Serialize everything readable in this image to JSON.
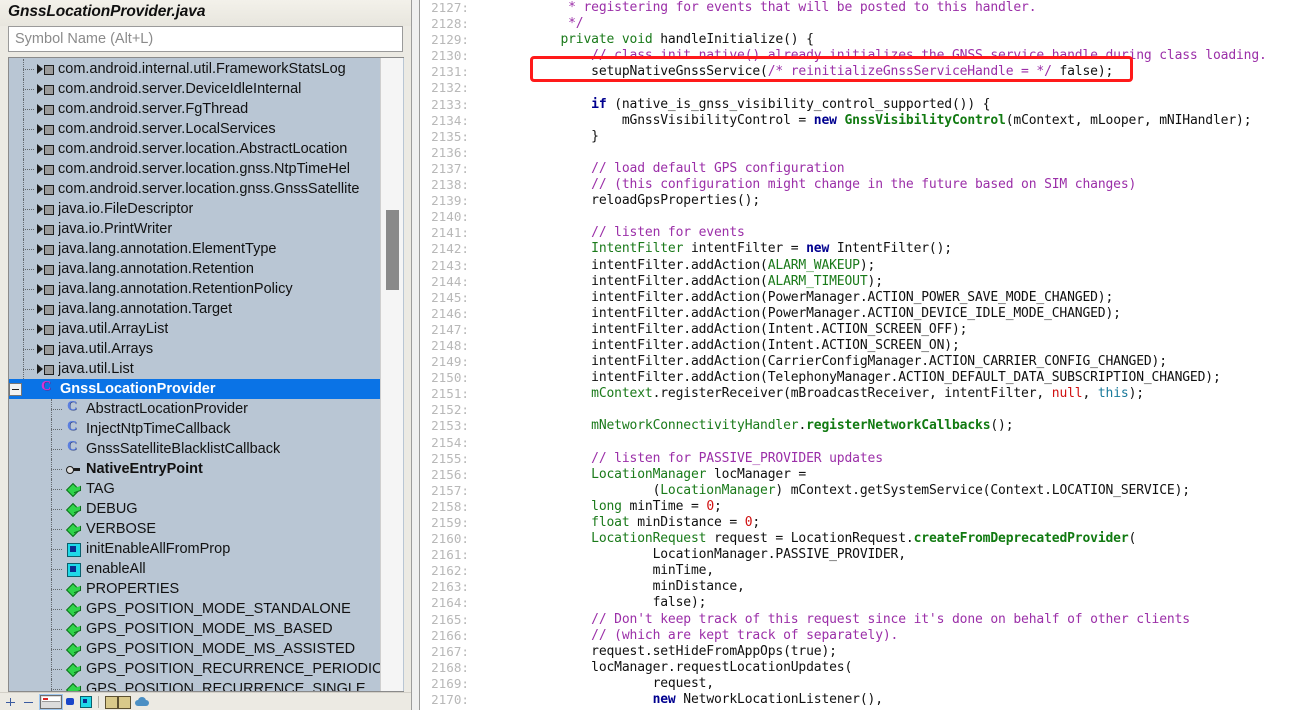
{
  "panel": {
    "title": "GnssLocationProvider.java",
    "search_placeholder": "Symbol Name (Alt+L)",
    "search_value": "",
    "tree": [
      {
        "label": "com.android.internal.util.FrameworkStatsLog",
        "icon": "import-icon",
        "kind": "import",
        "depth": 1,
        "selected": false
      },
      {
        "label": "com.android.server.DeviceIdleInternal",
        "icon": "import-icon",
        "kind": "import",
        "depth": 1,
        "selected": false
      },
      {
        "label": "com.android.server.FgThread",
        "icon": "import-icon",
        "kind": "import",
        "depth": 1,
        "selected": false
      },
      {
        "label": "com.android.server.LocalServices",
        "icon": "import-icon",
        "kind": "import",
        "depth": 1,
        "selected": false
      },
      {
        "label": "com.android.server.location.AbstractLocation",
        "icon": "import-icon",
        "kind": "import",
        "depth": 1,
        "selected": false
      },
      {
        "label": "com.android.server.location.gnss.NtpTimeHel",
        "icon": "import-icon",
        "kind": "import",
        "depth": 1,
        "selected": false
      },
      {
        "label": "com.android.server.location.gnss.GnssSatellite",
        "icon": "import-icon",
        "kind": "import",
        "depth": 1,
        "selected": false
      },
      {
        "label": "java.io.FileDescriptor",
        "icon": "import-icon",
        "kind": "import",
        "depth": 1,
        "selected": false
      },
      {
        "label": "java.io.PrintWriter",
        "icon": "import-icon",
        "kind": "import",
        "depth": 1,
        "selected": false
      },
      {
        "label": "java.lang.annotation.ElementType",
        "icon": "import-icon",
        "kind": "import",
        "depth": 1,
        "selected": false
      },
      {
        "label": "java.lang.annotation.Retention",
        "icon": "import-icon",
        "kind": "import",
        "depth": 1,
        "selected": false
      },
      {
        "label": "java.lang.annotation.RetentionPolicy",
        "icon": "import-icon",
        "kind": "import",
        "depth": 1,
        "selected": false
      },
      {
        "label": "java.lang.annotation.Target",
        "icon": "import-icon",
        "kind": "import",
        "depth": 1,
        "selected": false
      },
      {
        "label": "java.util.ArrayList",
        "icon": "import-icon",
        "kind": "import",
        "depth": 1,
        "selected": false
      },
      {
        "label": "java.util.Arrays",
        "icon": "import-icon",
        "kind": "import",
        "depth": 1,
        "selected": false
      },
      {
        "label": "java.util.List",
        "icon": "import-icon",
        "kind": "import",
        "depth": 1,
        "selected": false
      },
      {
        "label": "GnssLocationProvider",
        "icon": "class-icon",
        "kind": "class-selected",
        "depth": 0,
        "selected": true,
        "expanded": true
      },
      {
        "label": "AbstractLocationProvider",
        "icon": "class-icon",
        "kind": "class",
        "depth": 2,
        "selected": false
      },
      {
        "label": "InjectNtpTimeCallback",
        "icon": "class-icon",
        "kind": "class",
        "depth": 2,
        "selected": false
      },
      {
        "label": "GnssSatelliteBlacklistCallback",
        "icon": "class-icon",
        "kind": "class",
        "depth": 2,
        "selected": false
      },
      {
        "label": "NativeEntryPoint",
        "icon": "interface-icon",
        "kind": "interface",
        "depth": 2,
        "selected": false
      },
      {
        "label": "TAG",
        "icon": "field-icon",
        "kind": "field",
        "depth": 2,
        "selected": false
      },
      {
        "label": "DEBUG",
        "icon": "field-icon",
        "kind": "field",
        "depth": 2,
        "selected": false
      },
      {
        "label": "VERBOSE",
        "icon": "field-icon",
        "kind": "field",
        "depth": 2,
        "selected": false
      },
      {
        "label": "initEnableAllFromProp",
        "icon": "method-icon",
        "kind": "method",
        "depth": 2,
        "selected": false
      },
      {
        "label": "enableAll",
        "icon": "method-icon",
        "kind": "method",
        "depth": 2,
        "selected": false
      },
      {
        "label": "PROPERTIES",
        "icon": "field-icon",
        "kind": "field",
        "depth": 2,
        "selected": false
      },
      {
        "label": "GPS_POSITION_MODE_STANDALONE",
        "icon": "field-icon",
        "kind": "field",
        "depth": 2,
        "selected": false
      },
      {
        "label": "GPS_POSITION_MODE_MS_BASED",
        "icon": "field-icon",
        "kind": "field",
        "depth": 2,
        "selected": false
      },
      {
        "label": "GPS_POSITION_MODE_MS_ASSISTED",
        "icon": "field-icon",
        "kind": "field",
        "depth": 2,
        "selected": false
      },
      {
        "label": "GPS_POSITION_RECURRENCE_PERIODIC",
        "icon": "field-icon",
        "kind": "field",
        "depth": 2,
        "selected": false
      },
      {
        "label": "GPS_POSITION_RECURRENCE_SINGLE",
        "icon": "field-icon",
        "kind": "field",
        "depth": 2,
        "selected": false
      }
    ],
    "toolbar": [
      {
        "name": "expand-plus-button",
        "icon": "plus-icon"
      },
      {
        "name": "collapse-minus-button",
        "icon": "minus-icon"
      },
      {
        "name": "window-view-button",
        "icon": "window-icon"
      },
      {
        "name": "symbol-dot-button",
        "icon": "blue-dot-icon"
      },
      {
        "name": "method-filter-button",
        "icon": "cyan-square-icon"
      },
      {
        "name": "books-button",
        "icon": "books-icon"
      },
      {
        "name": "cloud-button",
        "icon": "cloud-icon"
      }
    ]
  },
  "editor": {
    "accent_highlight_color": "#ff1a1a",
    "first_line_number": 2127,
    "lines": [
      {
        "n": "2127:",
        "tokens": [
          {
            "t": "            * registering for events that will be posted to this handler.",
            "c": "cmt"
          }
        ]
      },
      {
        "n": "2128:",
        "tokens": [
          {
            "t": "            */",
            "c": "cmt"
          }
        ]
      },
      {
        "n": "2129:",
        "tokens": [
          {
            "t": "           ",
            "c": "pl"
          },
          {
            "t": "private void",
            "c": "typ"
          },
          {
            "t": " handleInitialize() {",
            "c": "pl"
          }
        ]
      },
      {
        "n": "2130:",
        "tokens": [
          {
            "t": "               ",
            "c": "pl"
          },
          {
            "t": "// class init native() already initializes the GNSS service handle during class loading.",
            "c": "cmt"
          }
        ]
      },
      {
        "n": "2131:",
        "tokens": [
          {
            "t": "               setupNativeGnssService(",
            "c": "pl"
          },
          {
            "t": "/* reinitializeGnssServiceHandle = */",
            "c": "cmt"
          },
          {
            "t": " false);",
            "c": "pl"
          }
        ]
      },
      {
        "n": "2132:",
        "tokens": [
          {
            "t": "",
            "c": "pl"
          }
        ]
      },
      {
        "n": "2133:",
        "tokens": [
          {
            "t": "               ",
            "c": "pl"
          },
          {
            "t": "if",
            "c": "kw"
          },
          {
            "t": " (native_is_gnss_visibility_control_supported()) {",
            "c": "pl"
          }
        ]
      },
      {
        "n": "2134:",
        "tokens": [
          {
            "t": "                   mGnssVisibilityControl = ",
            "c": "pl"
          },
          {
            "t": "new",
            "c": "kw"
          },
          {
            "t": " ",
            "c": "pl"
          },
          {
            "t": "GnssVisibilityControl",
            "c": "cls"
          },
          {
            "t": "(mContext, mLooper, mNIHandler);",
            "c": "pl"
          }
        ]
      },
      {
        "n": "2135:",
        "tokens": [
          {
            "t": "               }",
            "c": "pl"
          }
        ]
      },
      {
        "n": "2136:",
        "tokens": [
          {
            "t": "",
            "c": "pl"
          }
        ]
      },
      {
        "n": "2137:",
        "tokens": [
          {
            "t": "               ",
            "c": "pl"
          },
          {
            "t": "// load default GPS configuration",
            "c": "cmt"
          }
        ]
      },
      {
        "n": "2138:",
        "tokens": [
          {
            "t": "               ",
            "c": "pl"
          },
          {
            "t": "// (this configuration might change in the future based on SIM changes)",
            "c": "cmt"
          }
        ]
      },
      {
        "n": "2139:",
        "tokens": [
          {
            "t": "               reloadGpsProperties();",
            "c": "pl"
          }
        ]
      },
      {
        "n": "2140:",
        "tokens": [
          {
            "t": "",
            "c": "pl"
          }
        ]
      },
      {
        "n": "2141:",
        "tokens": [
          {
            "t": "               ",
            "c": "pl"
          },
          {
            "t": "// listen for events",
            "c": "cmt"
          }
        ]
      },
      {
        "n": "2142:",
        "tokens": [
          {
            "t": "               ",
            "c": "pl"
          },
          {
            "t": "IntentFilter",
            "c": "typ"
          },
          {
            "t": " intentFilter = ",
            "c": "pl"
          },
          {
            "t": "new",
            "c": "kw"
          },
          {
            "t": " IntentFilter();",
            "c": "pl"
          }
        ]
      },
      {
        "n": "2143:",
        "tokens": [
          {
            "t": "               intentFilter.addAction(",
            "c": "pl"
          },
          {
            "t": "ALARM_WAKEUP",
            "c": "fld"
          },
          {
            "t": ");",
            "c": "pl"
          }
        ]
      },
      {
        "n": "2144:",
        "tokens": [
          {
            "t": "               intentFilter.addAction(",
            "c": "pl"
          },
          {
            "t": "ALARM_TIMEOUT",
            "c": "fld"
          },
          {
            "t": ");",
            "c": "pl"
          }
        ]
      },
      {
        "n": "2145:",
        "tokens": [
          {
            "t": "               intentFilter.addAction(PowerManager.ACTION_POWER_SAVE_MODE_CHANGED);",
            "c": "pl"
          }
        ]
      },
      {
        "n": "2146:",
        "tokens": [
          {
            "t": "               intentFilter.addAction(PowerManager.ACTION_DEVICE_IDLE_MODE_CHANGED);",
            "c": "pl"
          }
        ]
      },
      {
        "n": "2147:",
        "tokens": [
          {
            "t": "               intentFilter.addAction(Intent.ACTION_SCREEN_OFF);",
            "c": "pl"
          }
        ]
      },
      {
        "n": "2148:",
        "tokens": [
          {
            "t": "               intentFilter.addAction(Intent.ACTION_SCREEN_ON);",
            "c": "pl"
          }
        ]
      },
      {
        "n": "2149:",
        "tokens": [
          {
            "t": "               intentFilter.addAction(CarrierConfigManager.ACTION_CARRIER_CONFIG_CHANGED);",
            "c": "pl"
          }
        ]
      },
      {
        "n": "2150:",
        "tokens": [
          {
            "t": "               intentFilter.addAction(TelephonyManager.ACTION_DEFAULT_DATA_SUBSCRIPTION_CHANGED);",
            "c": "pl"
          }
        ]
      },
      {
        "n": "2151:",
        "tokens": [
          {
            "t": "               ",
            "c": "pl"
          },
          {
            "t": "mContext",
            "c": "fld"
          },
          {
            "t": ".registerReceiver(mBroadcastReceiver, intentFilter, ",
            "c": "pl"
          },
          {
            "t": "null",
            "c": "null"
          },
          {
            "t": ", ",
            "c": "pl"
          },
          {
            "t": "this",
            "c": "this"
          },
          {
            "t": ");",
            "c": "pl"
          }
        ]
      },
      {
        "n": "2152:",
        "tokens": [
          {
            "t": "",
            "c": "pl"
          }
        ]
      },
      {
        "n": "2153:",
        "tokens": [
          {
            "t": "               ",
            "c": "pl"
          },
          {
            "t": "mNetworkConnectivityHandler",
            "c": "fld"
          },
          {
            "t": ".",
            "c": "pl"
          },
          {
            "t": "registerNetworkCallbacks",
            "c": "fn"
          },
          {
            "t": "();",
            "c": "pl"
          }
        ]
      },
      {
        "n": "2154:",
        "tokens": [
          {
            "t": "",
            "c": "pl"
          }
        ]
      },
      {
        "n": "2155:",
        "tokens": [
          {
            "t": "               ",
            "c": "pl"
          },
          {
            "t": "// listen for PASSIVE_PROVIDER updates",
            "c": "cmt"
          }
        ]
      },
      {
        "n": "2156:",
        "tokens": [
          {
            "t": "               ",
            "c": "pl"
          },
          {
            "t": "LocationManager",
            "c": "typ"
          },
          {
            "t": " locManager =",
            "c": "pl"
          }
        ]
      },
      {
        "n": "2157:",
        "tokens": [
          {
            "t": "                       (",
            "c": "pl"
          },
          {
            "t": "LocationManager",
            "c": "typ"
          },
          {
            "t": ") mContext.getSystemService(Context.LOCATION_SERVICE);",
            "c": "pl"
          }
        ]
      },
      {
        "n": "2158:",
        "tokens": [
          {
            "t": "               ",
            "c": "pl"
          },
          {
            "t": "long",
            "c": "typ"
          },
          {
            "t": " minTime = ",
            "c": "pl"
          },
          {
            "t": "0",
            "c": "num"
          },
          {
            "t": ";",
            "c": "pl"
          }
        ]
      },
      {
        "n": "2159:",
        "tokens": [
          {
            "t": "               ",
            "c": "pl"
          },
          {
            "t": "float",
            "c": "typ"
          },
          {
            "t": " minDistance = ",
            "c": "pl"
          },
          {
            "t": "0",
            "c": "num"
          },
          {
            "t": ";",
            "c": "pl"
          }
        ]
      },
      {
        "n": "2160:",
        "tokens": [
          {
            "t": "               ",
            "c": "pl"
          },
          {
            "t": "LocationRequest",
            "c": "typ"
          },
          {
            "t": " request = LocationRequest.",
            "c": "pl"
          },
          {
            "t": "createFromDeprecatedProvider",
            "c": "fn"
          },
          {
            "t": "(",
            "c": "pl"
          }
        ]
      },
      {
        "n": "2161:",
        "tokens": [
          {
            "t": "                       LocationManager.PASSIVE_PROVIDER,",
            "c": "pl"
          }
        ]
      },
      {
        "n": "2162:",
        "tokens": [
          {
            "t": "                       minTime,",
            "c": "pl"
          }
        ]
      },
      {
        "n": "2163:",
        "tokens": [
          {
            "t": "                       minDistance,",
            "c": "pl"
          }
        ]
      },
      {
        "n": "2164:",
        "tokens": [
          {
            "t": "                       false);",
            "c": "pl"
          }
        ]
      },
      {
        "n": "2165:",
        "tokens": [
          {
            "t": "               ",
            "c": "pl"
          },
          {
            "t": "// Don't keep track of this request since it's done on behalf of other clients",
            "c": "cmt"
          }
        ]
      },
      {
        "n": "2166:",
        "tokens": [
          {
            "t": "               ",
            "c": "pl"
          },
          {
            "t": "// (which are kept track of separately).",
            "c": "cmt"
          }
        ]
      },
      {
        "n": "2167:",
        "tokens": [
          {
            "t": "               request.setHideFromAppOps(true);",
            "c": "pl"
          }
        ]
      },
      {
        "n": "2168:",
        "tokens": [
          {
            "t": "               locManager.requestLocationUpdates(",
            "c": "pl"
          }
        ]
      },
      {
        "n": "2169:",
        "tokens": [
          {
            "t": "                       request,",
            "c": "pl"
          }
        ]
      },
      {
        "n": "2170:",
        "tokens": [
          {
            "t": "                       ",
            "c": "pl"
          },
          {
            "t": "new",
            "c": "kw"
          },
          {
            "t": " NetworkLocationListener(),",
            "c": "pl"
          }
        ]
      }
    ]
  }
}
